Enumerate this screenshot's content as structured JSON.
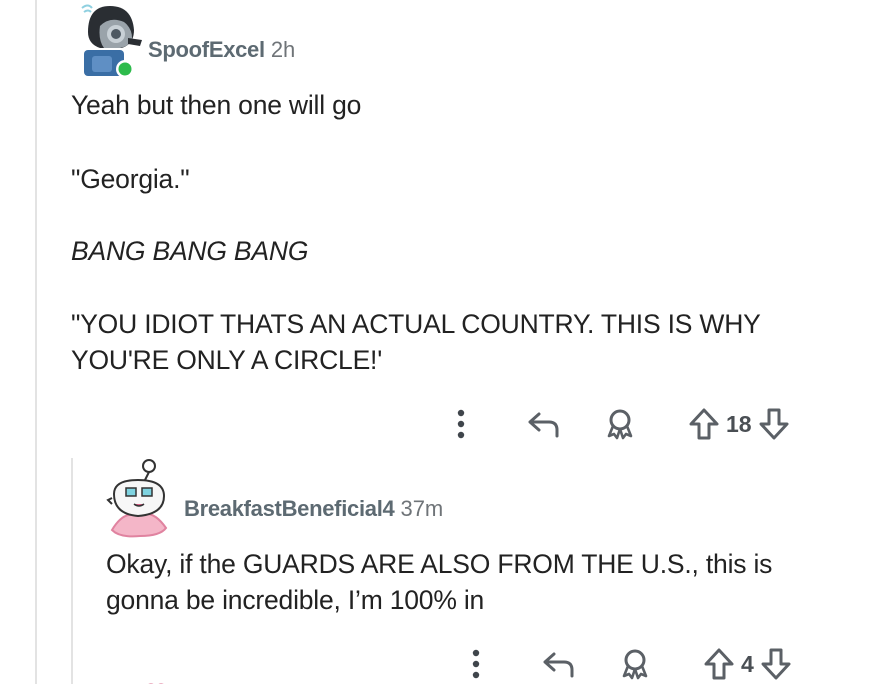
{
  "colors": {
    "thread_line": "#e3e3e3",
    "online_dot": "#2dbb4c",
    "username": "#5d6a72",
    "icon": "#5b6066"
  },
  "comment1": {
    "username": "SpoofExcel",
    "time": "2h",
    "online": true,
    "avatar": "snoo-avatar-helmet-icon",
    "lines": [
      {
        "text": "Yeah but then one will go",
        "italic": false
      },
      {
        "text": "\"Georgia.\"",
        "italic": false
      },
      {
        "text": "BANG BANG BANG",
        "italic": true
      },
      {
        "text": "\"YOU IDIOT THATS AN ACTUAL COUNTRY. THIS IS WHY YOU'RE ONLY A CIRCLE!'",
        "italic": false
      }
    ],
    "votes": "18"
  },
  "comment2": {
    "username": "BreakfastBeneficial4",
    "time": "37m",
    "avatar": "snoo-avatar-robot-icon",
    "text": "Okay, if the GUARDS ARE ALSO FROM THE U.S., this is gonna be incredible, I’m 100% in",
    "votes": "4"
  }
}
